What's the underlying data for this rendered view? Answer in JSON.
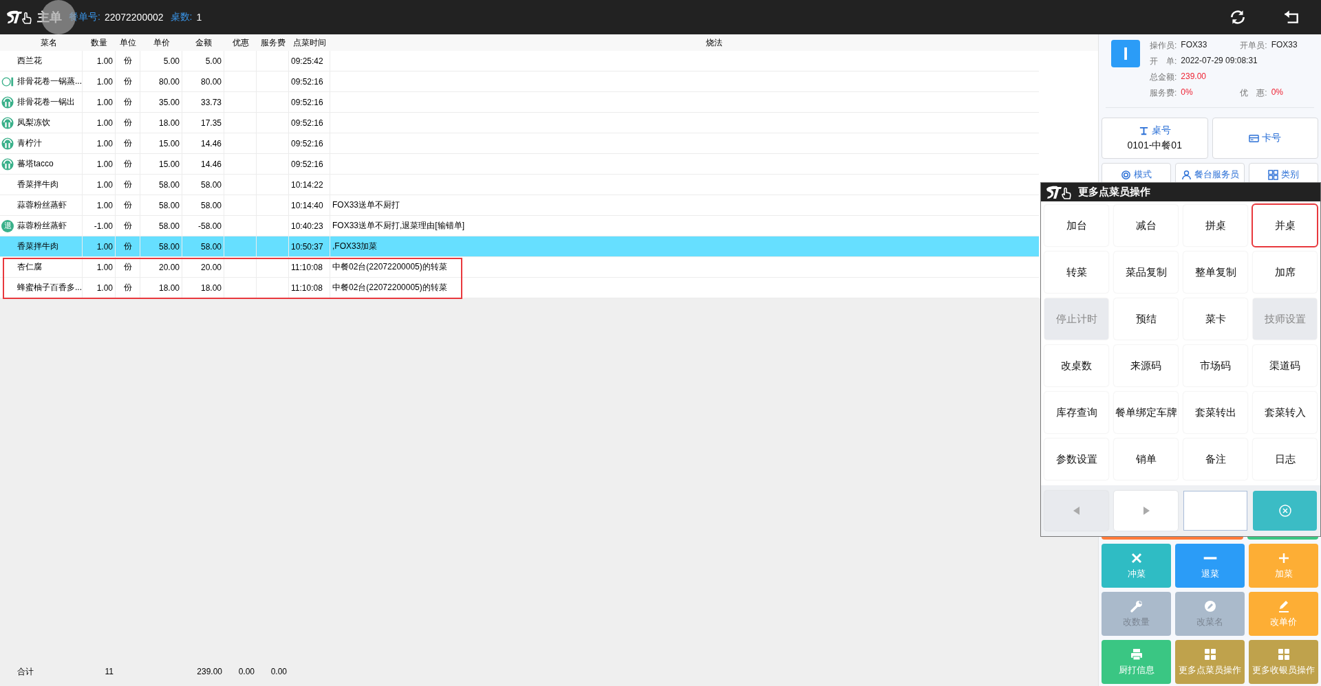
{
  "header": {
    "title": "主单",
    "order_label": "餐单号:",
    "order_no": "22072200002",
    "tables_label": "桌数:",
    "tables": "1"
  },
  "table": {
    "columns": [
      "菜名",
      "数量",
      "单位",
      "单价",
      "金额",
      "优惠",
      "服务费",
      "点菜时间",
      "烧法"
    ],
    "rows": [
      {
        "kind": "none",
        "name": "西兰花",
        "qty": "1.00",
        "unit": "份",
        "price": "5.00",
        "amount": "5.00",
        "time": "09:25:42",
        "note": "",
        "selected": false,
        "highlighted": false
      },
      {
        "kind": "pending",
        "name": "排骨花卷一锅蒸...",
        "qty": "1.00",
        "unit": "份",
        "price": "80.00",
        "amount": "80.00",
        "time": "09:52:16",
        "note": "",
        "selected": false,
        "highlighted": false
      },
      {
        "kind": "served",
        "name": "排骨花卷一锅出",
        "qty": "1.00",
        "unit": "份",
        "price": "35.00",
        "amount": "33.73",
        "time": "09:52:16",
        "note": "",
        "selected": false,
        "highlighted": false
      },
      {
        "kind": "served",
        "name": "凤梨冻饮",
        "qty": "1.00",
        "unit": "份",
        "price": "18.00",
        "amount": "17.35",
        "time": "09:52:16",
        "note": "",
        "selected": false,
        "highlighted": false
      },
      {
        "kind": "served",
        "name": "青柠汁",
        "qty": "1.00",
        "unit": "份",
        "price": "15.00",
        "amount": "14.46",
        "time": "09:52:16",
        "note": "",
        "selected": false,
        "highlighted": false
      },
      {
        "kind": "served",
        "name": "蕃塔tacco",
        "qty": "1.00",
        "unit": "份",
        "price": "15.00",
        "amount": "14.46",
        "time": "09:52:16",
        "note": "",
        "selected": false,
        "highlighted": false
      },
      {
        "kind": "none",
        "name": "香菜拌牛肉",
        "qty": "1.00",
        "unit": "份",
        "price": "58.00",
        "amount": "58.00",
        "time": "10:14:22",
        "note": "",
        "selected": false,
        "highlighted": false
      },
      {
        "kind": "none",
        "name": "蒜蓉粉丝蒸虾",
        "qty": "1.00",
        "unit": "份",
        "price": "58.00",
        "amount": "58.00",
        "time": "10:14:40",
        "note": "FOX33送单不厨打",
        "selected": false,
        "highlighted": false
      },
      {
        "kind": "returned",
        "badge": "退",
        "name": "蒜蓉粉丝蒸虾",
        "qty": "-1.00",
        "unit": "份",
        "price": "58.00",
        "amount": "-58.00",
        "time": "10:40:23",
        "note": "FOX33送单不厨打,退菜理由[输错单]",
        "selected": false,
        "highlighted": false
      },
      {
        "kind": "none",
        "name": "香菜拌牛肉",
        "qty": "1.00",
        "unit": "份",
        "price": "58.00",
        "amount": "58.00",
        "time": "10:50:37",
        "note": ",FOX33加菜",
        "selected": true,
        "highlighted": false
      },
      {
        "kind": "none",
        "name": "杏仁腐",
        "qty": "1.00",
        "unit": "份",
        "price": "20.00",
        "amount": "20.00",
        "time": "11:10:08",
        "note": "中餐02台(22072200005)的转菜",
        "selected": false,
        "highlighted": true
      },
      {
        "kind": "none",
        "name": "蜂蜜柚子百香多...",
        "qty": "1.00",
        "unit": "份",
        "price": "18.00",
        "amount": "18.00",
        "time": "11:10:08",
        "note": "中餐02台(22072200005)的转菜",
        "selected": false,
        "highlighted": true
      }
    ],
    "footer": {
      "label": "合计",
      "qty": "11",
      "amount": "239.00",
      "discount": "0.00",
      "service": "0.00"
    }
  },
  "info": {
    "avatar": "I",
    "operator_label": "操作员:",
    "operator": "FOX33",
    "opener_label": "开单员:",
    "opener": "FOX33",
    "open_label": "开　单:",
    "open_time": "2022-07-29 09:08:31",
    "total_label": "总金额:",
    "total": "239.00",
    "service_label": "服务费:",
    "service": "0%",
    "discount_label": "优　惠:",
    "discount": "0%"
  },
  "table_button": {
    "label": "桌号",
    "value": "0101-中餐01"
  },
  "card_button": {
    "label": "卡号"
  },
  "mode_buttons": [
    {
      "kind": "mode",
      "label": "模式"
    },
    {
      "kind": "waiter",
      "label": "餐台服务员"
    },
    {
      "kind": "category",
      "label": "类别"
    }
  ],
  "actions": [
    {
      "kind": "clear",
      "label": "冲菜",
      "color": "#2fbcc4",
      "disabled": false
    },
    {
      "kind": "return",
      "label": "退菜",
      "color": "#2b9cf7",
      "disabled": false
    },
    {
      "kind": "add",
      "label": "加菜",
      "color": "#fdae35",
      "disabled": false
    },
    {
      "kind": "quantity",
      "label": "改数量",
      "color": "#aabacb",
      "disabled": true
    },
    {
      "kind": "rename",
      "label": "改菜名",
      "color": "#aabacb",
      "disabled": true
    },
    {
      "kind": "price",
      "label": "改单价",
      "color": "#fdae35",
      "disabled": false
    },
    {
      "kind": "print",
      "label": "厨打信息",
      "color": "#3ac683",
      "disabled": false
    },
    {
      "kind": "more",
      "label": "更多点菜员操作",
      "color": "#bfa24c",
      "disabled": false
    },
    {
      "kind": "more",
      "label": "更多收银员操作",
      "color": "#bfa24c",
      "disabled": false
    }
  ],
  "popup": {
    "title": "更多点菜员操作",
    "buttons": [
      {
        "label": "加台",
        "disabled": false,
        "highlighted": false
      },
      {
        "label": "减台",
        "disabled": false,
        "highlighted": false
      },
      {
        "label": "拼桌",
        "disabled": false,
        "highlighted": false
      },
      {
        "label": "并桌",
        "disabled": false,
        "highlighted": true
      },
      {
        "label": "转菜",
        "disabled": false,
        "highlighted": false
      },
      {
        "label": "菜品复制",
        "disabled": false,
        "highlighted": false
      },
      {
        "label": "整单复制",
        "disabled": false,
        "highlighted": false
      },
      {
        "label": "加席",
        "disabled": false,
        "highlighted": false
      },
      {
        "label": "停止计时",
        "disabled": true,
        "highlighted": false
      },
      {
        "label": "预结",
        "disabled": false,
        "highlighted": false
      },
      {
        "label": "菜卡",
        "disabled": false,
        "highlighted": false
      },
      {
        "label": "技师设置",
        "disabled": true,
        "highlighted": false
      },
      {
        "label": "改桌数",
        "disabled": false,
        "highlighted": false
      },
      {
        "label": "来源码",
        "disabled": false,
        "highlighted": false
      },
      {
        "label": "市场码",
        "disabled": false,
        "highlighted": false
      },
      {
        "label": "渠道码",
        "disabled": false,
        "highlighted": false
      },
      {
        "label": "库存查询",
        "disabled": false,
        "highlighted": false
      },
      {
        "label": "餐单绑定车牌",
        "disabled": false,
        "highlighted": false
      },
      {
        "label": "套菜转出",
        "disabled": false,
        "highlighted": false
      },
      {
        "label": "套菜转入",
        "disabled": false,
        "highlighted": false
      },
      {
        "label": "参数设置",
        "disabled": false,
        "highlighted": false
      },
      {
        "label": "销单",
        "disabled": false,
        "highlighted": false
      },
      {
        "label": "备注",
        "disabled": false,
        "highlighted": false
      },
      {
        "label": "日志",
        "disabled": false,
        "highlighted": false
      }
    ],
    "prev_disabled": true
  }
}
